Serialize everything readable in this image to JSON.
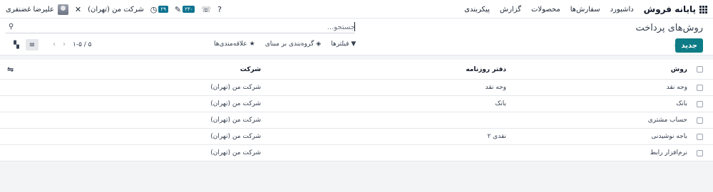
{
  "navbar": {
    "app_name": "پایانه فروش",
    "menu": [
      "داشبورد",
      "سفارش‌ها",
      "محصولات",
      "گزارش",
      "پیکربندی"
    ],
    "user_name": "علیرضا غضنفری",
    "company": "شرکت من (تهران)",
    "activity_count": "۲۹",
    "messages_count": "۲۳۰",
    "icons": [
      "settings-tools-icon",
      "clock-icon",
      "chat-icon",
      "phone-icon",
      "help-icon",
      "apps-grid-icon"
    ]
  },
  "control": {
    "title": "روش‌های پرداخت",
    "search_placeholder": "جستجو...",
    "new_label": "جدید",
    "filters_label": "فیلترها",
    "group_by_label": "گروه‌بندی بر مبنای",
    "favorites_label": "علاقه‌مندی‌ها",
    "pager": "۱-۵ / ۵"
  },
  "table": {
    "headers": {
      "name": "روش",
      "journal": "دفتر روزنامه",
      "company": "شرکت"
    },
    "rows": [
      {
        "name": "وجه نقد",
        "journal": "وجه نقد",
        "company": "شرکت من (تهران)"
      },
      {
        "name": "بانک",
        "journal": "بانک",
        "company": "شرکت من (تهران)"
      },
      {
        "name": "حساب مشتری",
        "journal": "",
        "company": "شرکت من (تهران)"
      },
      {
        "name": "باجه نوشیدنی",
        "journal": "نقدی ۲",
        "company": "شرکت من (تهران)"
      },
      {
        "name": "نرم‌افزار رابط",
        "journal": "",
        "company": "شرکت من (تهران)"
      }
    ]
  },
  "colors": {
    "accent": "#0e7c86",
    "badge": "#0e7490"
  }
}
